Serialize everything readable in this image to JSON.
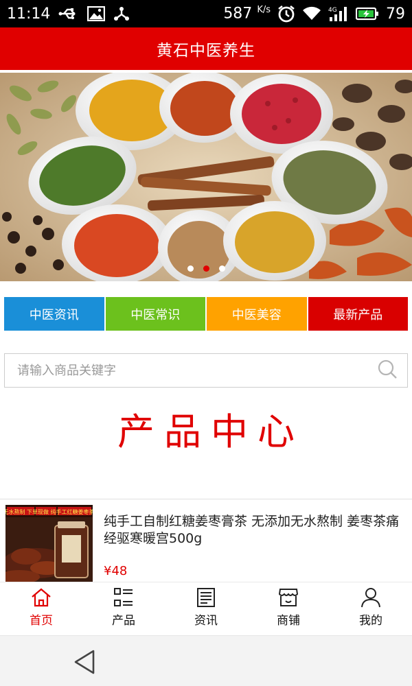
{
  "statusbar": {
    "time": "11:14",
    "network_speed": "587",
    "network_unit": "K/s",
    "network_type": "4G",
    "battery": "79",
    "icons": [
      "usb-icon",
      "image-icon",
      "share-icon",
      "alarm-icon",
      "wifi-icon",
      "signal-icon",
      "battery-icon"
    ]
  },
  "app": {
    "title": "黄石中医养生",
    "accent": "#e00000"
  },
  "banner": {
    "slide_count": 3,
    "active_slide": 2
  },
  "categories": [
    {
      "label": "中医资讯",
      "color": "#1a8fd8"
    },
    {
      "label": "中医常识",
      "color": "#6cc11d"
    },
    {
      "label": "中医美容",
      "color": "#ffa200"
    },
    {
      "label": "最新产品",
      "color": "#d90000"
    }
  ],
  "search": {
    "placeholder": "请输入商品关键字"
  },
  "section": {
    "title": "产品中心"
  },
  "products": [
    {
      "title": "纯手工自制红糖姜枣膏茶 无添加无水熬制 姜枣茶痛经驱寒暖宫500g",
      "price": "¥48",
      "image_caption": "无水熬制 下单现做 纯手工红糖姜枣茶"
    }
  ],
  "bottom_nav": [
    {
      "label": "首页",
      "icon": "home-icon",
      "active": true
    },
    {
      "label": "产品",
      "icon": "list-icon",
      "active": false
    },
    {
      "label": "资讯",
      "icon": "news-icon",
      "active": false
    },
    {
      "label": "商铺",
      "icon": "store-icon",
      "active": false
    },
    {
      "label": "我的",
      "icon": "user-icon",
      "active": false
    }
  ],
  "system_nav": {
    "back_icon": "back-triangle-icon"
  }
}
